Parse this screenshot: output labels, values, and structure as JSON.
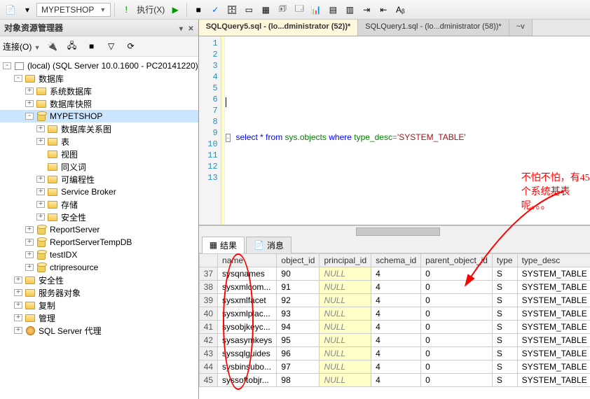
{
  "toolbar": {
    "db_combo": "MYPETSHOP",
    "execute_label": "执行(X)"
  },
  "explorer": {
    "title": "对象资源管理器",
    "connect_label": "连接(O)",
    "root": "(local) (SQL Server 10.0.1600 - PC20141220)",
    "databases": "数据库",
    "sys_databases": "系统数据库",
    "db_snapshots": "数据库快照",
    "mypetshop": "MYPETSHOP",
    "db_diagrams": "数据库关系图",
    "tables": "表",
    "views": "视图",
    "synonyms": "同义词",
    "programmability": "可编程性",
    "service_broker": "Service Broker",
    "storage": "存储",
    "db_security": "安全性",
    "reportserver": "ReportServer",
    "reportservertempdb": "ReportServerTempDB",
    "testidx": "testIDX",
    "ctripresource": "ctripresource",
    "security": "安全性",
    "server_objects": "服务器对象",
    "replication": "复制",
    "management": "管理",
    "sql_agent": "SQL Server 代理"
  },
  "tabs": {
    "tab1": "SQLQuery5.sql - (lo...dministrator (52))*",
    "tab2": "SQLQuery1.sql - (lo...dministrator (58))*",
    "tab3": "~v"
  },
  "editor": {
    "line_prefix": "select * from ",
    "sys_objects": "sys.objects",
    "where": " where ",
    "type_desc_col": "type_desc",
    "eq": "=",
    "str_val": "'SYSTEM_TABLE'"
  },
  "result_tabs": {
    "results": "结果",
    "messages": "消息"
  },
  "grid": {
    "columns": [
      "",
      "name",
      "object_id",
      "principal_id",
      "schema_id",
      "parent_object_id",
      "type",
      "type_desc"
    ],
    "rows": [
      {
        "n": "37",
        "name": "sysqnames",
        "oid": "90",
        "pid": "NULL",
        "sid": "4",
        "poid": "0",
        "t": "S",
        "td": "SYSTEM_TABLE"
      },
      {
        "n": "38",
        "name": "sysxmlcom...",
        "oid": "91",
        "pid": "NULL",
        "sid": "4",
        "poid": "0",
        "t": "S",
        "td": "SYSTEM_TABLE"
      },
      {
        "n": "39",
        "name": "sysxmlfacet",
        "oid": "92",
        "pid": "NULL",
        "sid": "4",
        "poid": "0",
        "t": "S",
        "td": "SYSTEM_TABLE"
      },
      {
        "n": "40",
        "name": "sysxmlplac...",
        "oid": "93",
        "pid": "NULL",
        "sid": "4",
        "poid": "0",
        "t": "S",
        "td": "SYSTEM_TABLE"
      },
      {
        "n": "41",
        "name": "sysobjkeyc...",
        "oid": "94",
        "pid": "NULL",
        "sid": "4",
        "poid": "0",
        "t": "S",
        "td": "SYSTEM_TABLE"
      },
      {
        "n": "42",
        "name": "sysasymkeys",
        "oid": "95",
        "pid": "NULL",
        "sid": "4",
        "poid": "0",
        "t": "S",
        "td": "SYSTEM_TABLE"
      },
      {
        "n": "43",
        "name": "syssqlguides",
        "oid": "96",
        "pid": "NULL",
        "sid": "4",
        "poid": "0",
        "t": "S",
        "td": "SYSTEM_TABLE"
      },
      {
        "n": "44",
        "name": "sysbinsubo...",
        "oid": "97",
        "pid": "NULL",
        "sid": "4",
        "poid": "0",
        "t": "S",
        "td": "SYSTEM_TABLE"
      },
      {
        "n": "45",
        "name": "syssoftobjr...",
        "oid": "98",
        "pid": "NULL",
        "sid": "4",
        "poid": "0",
        "t": "S",
        "td": "SYSTEM_TABLE"
      }
    ]
  },
  "annotation": "不怕不怕，有45个系统基表呢。。。"
}
